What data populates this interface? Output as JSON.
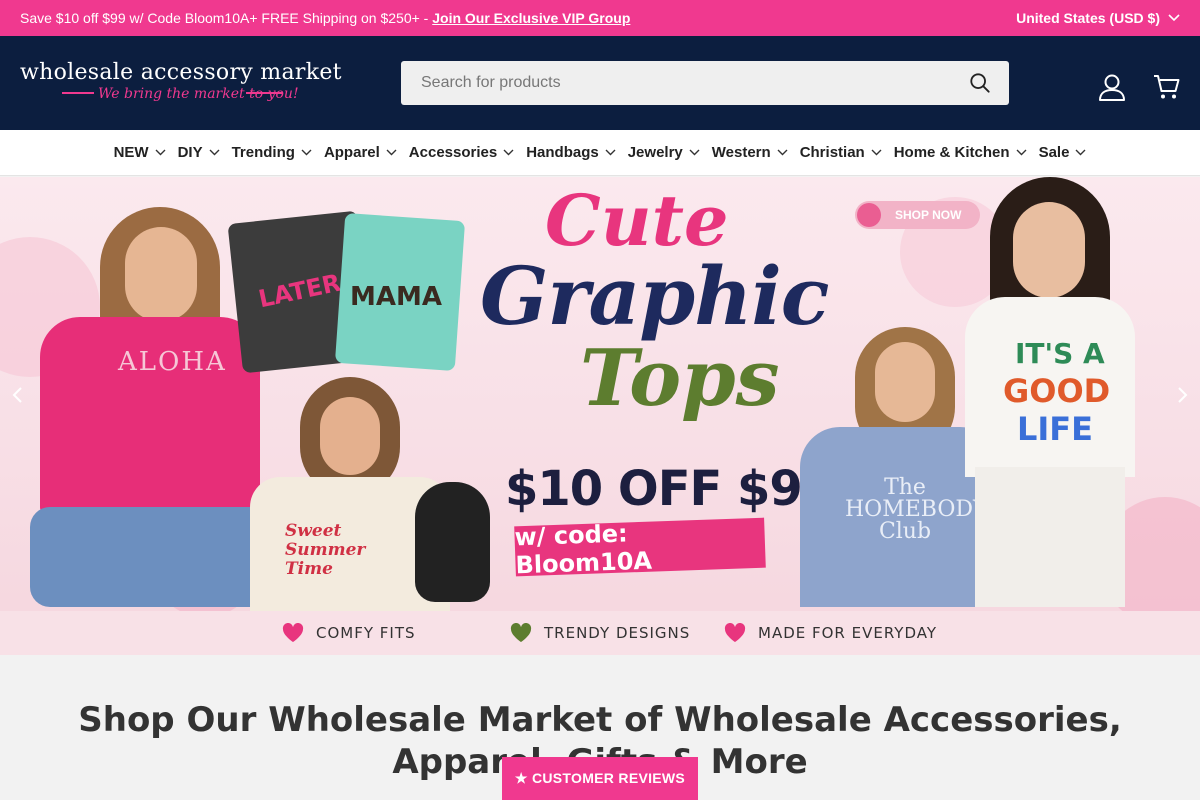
{
  "announcement": {
    "message": "Save $10 off $99 w/ Code Bloom10A+ FREE Shipping on $250+ - ",
    "link": "Join Our Exclusive VIP Group",
    "country": "United States (USD $)"
  },
  "header": {
    "logo_title": "wholesale accessory market",
    "logo_tagline": "We bring the market to you!",
    "search_placeholder": "Search for products"
  },
  "nav": {
    "items": [
      "NEW",
      "DIY",
      "Trending",
      "Apparel",
      "Accessories",
      "Handbags",
      "Jewelry",
      "Western",
      "Christian",
      "Home & Kitchen",
      "Sale"
    ]
  },
  "hero": {
    "line1": "Cute",
    "line2": "Graphic",
    "line3": "Tops",
    "offer": "$10 OFF $99",
    "code": "w/ code: Bloom10A",
    "shop_now": "SHOP NOW",
    "tee_aloha": "ALOHA",
    "tee_later": "LATER",
    "tee_mama": "MAMA",
    "tee_sweet": "Sweet Summer Time",
    "tee_homebody": "The HOMEBODY Club",
    "tee_good1": "IT'S A",
    "tee_good2": "GOOD",
    "tee_good3": "LIFE",
    "features": [
      "COMFY FITS",
      "TRENDY DESIGNS",
      "MADE FOR EVERYDAY"
    ]
  },
  "main": {
    "heading": "Shop Our Wholesale Market of Wholesale Accessories, Apparel, Gifts & More"
  },
  "reviews_button": "★ CUSTOMER REVIEWS",
  "colors": {
    "brand_pink": "#f0398f",
    "header_navy": "#0c1e3f"
  }
}
